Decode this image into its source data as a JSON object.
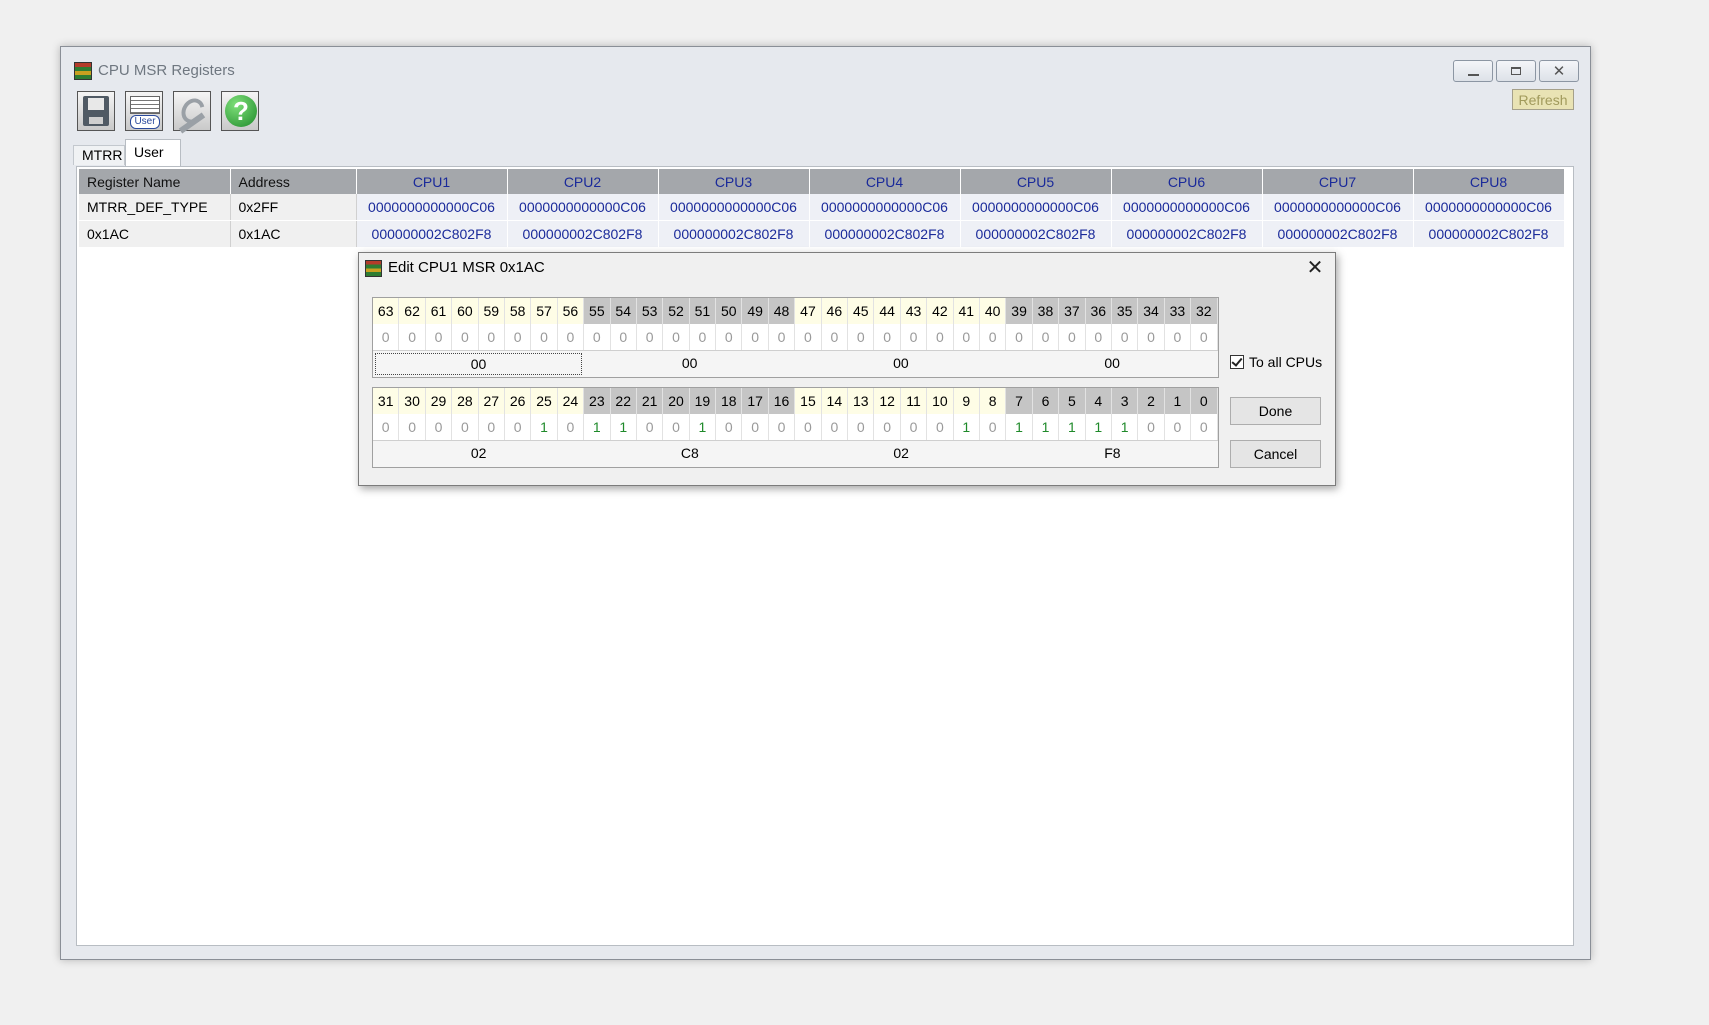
{
  "window": {
    "title": "CPU MSR Registers",
    "minimize": "",
    "maximize": "",
    "close": "✕"
  },
  "toolbar": {
    "refresh_label": "Refresh",
    "user_icon_text": "User",
    "help_glyph": "?"
  },
  "tabs": [
    {
      "label": "MTRR"
    },
    {
      "label": "User"
    }
  ],
  "table": {
    "headers": [
      "Register Name",
      "Address",
      "CPU1",
      "CPU2",
      "CPU3",
      "CPU4",
      "CPU5",
      "CPU6",
      "CPU7",
      "CPU8"
    ],
    "rows": [
      {
        "name": "MTRR_DEF_TYPE",
        "address": "0x2FF",
        "values": [
          "0000000000000C06",
          "0000000000000C06",
          "0000000000000C06",
          "0000000000000C06",
          "0000000000000C06",
          "0000000000000C06",
          "0000000000000C06",
          "0000000000000C06"
        ]
      },
      {
        "name": "0x1AC",
        "address": "0x1AC",
        "values": [
          "000000002C802F8",
          "000000002C802F8",
          "000000002C802F8",
          "000000002C802F8",
          "000000002C802F8",
          "000000002C802F8",
          "000000002C802F8",
          "000000002C802F8"
        ]
      }
    ]
  },
  "dialog": {
    "title": "Edit CPU1 MSR 0x1AC",
    "close_glyph": "✕",
    "high": {
      "bits": [
        "63",
        "62",
        "61",
        "60",
        "59",
        "58",
        "57",
        "56",
        "55",
        "54",
        "53",
        "52",
        "51",
        "50",
        "49",
        "48",
        "47",
        "46",
        "45",
        "44",
        "43",
        "42",
        "41",
        "40",
        "39",
        "38",
        "37",
        "36",
        "35",
        "34",
        "33",
        "32"
      ],
      "values": [
        "0",
        "0",
        "0",
        "0",
        "0",
        "0",
        "0",
        "0",
        "0",
        "0",
        "0",
        "0",
        "0",
        "0",
        "0",
        "0",
        "0",
        "0",
        "0",
        "0",
        "0",
        "0",
        "0",
        "0",
        "0",
        "0",
        "0",
        "0",
        "0",
        "0",
        "0",
        "0"
      ],
      "bytes": [
        "00",
        "00",
        "00",
        "00"
      ]
    },
    "low": {
      "bits": [
        "31",
        "30",
        "29",
        "28",
        "27",
        "26",
        "25",
        "24",
        "23",
        "22",
        "21",
        "20",
        "19",
        "18",
        "17",
        "16",
        "15",
        "14",
        "13",
        "12",
        "11",
        "10",
        "9",
        "8",
        "7",
        "6",
        "5",
        "4",
        "3",
        "2",
        "1",
        "0"
      ],
      "values": [
        "0",
        "0",
        "0",
        "0",
        "0",
        "0",
        "1",
        "0",
        "1",
        "1",
        "0",
        "0",
        "1",
        "0",
        "0",
        "0",
        "0",
        "0",
        "0",
        "0",
        "0",
        "0",
        "1",
        "0",
        "1",
        "1",
        "1",
        "1",
        "1",
        "0",
        "0",
        "0"
      ],
      "bytes": [
        "02",
        "C8",
        "02",
        "F8"
      ]
    },
    "to_all_cpus_label": "To all CPUs",
    "to_all_cpus_checked": true,
    "done_label": "Done",
    "cancel_label": "Cancel"
  }
}
